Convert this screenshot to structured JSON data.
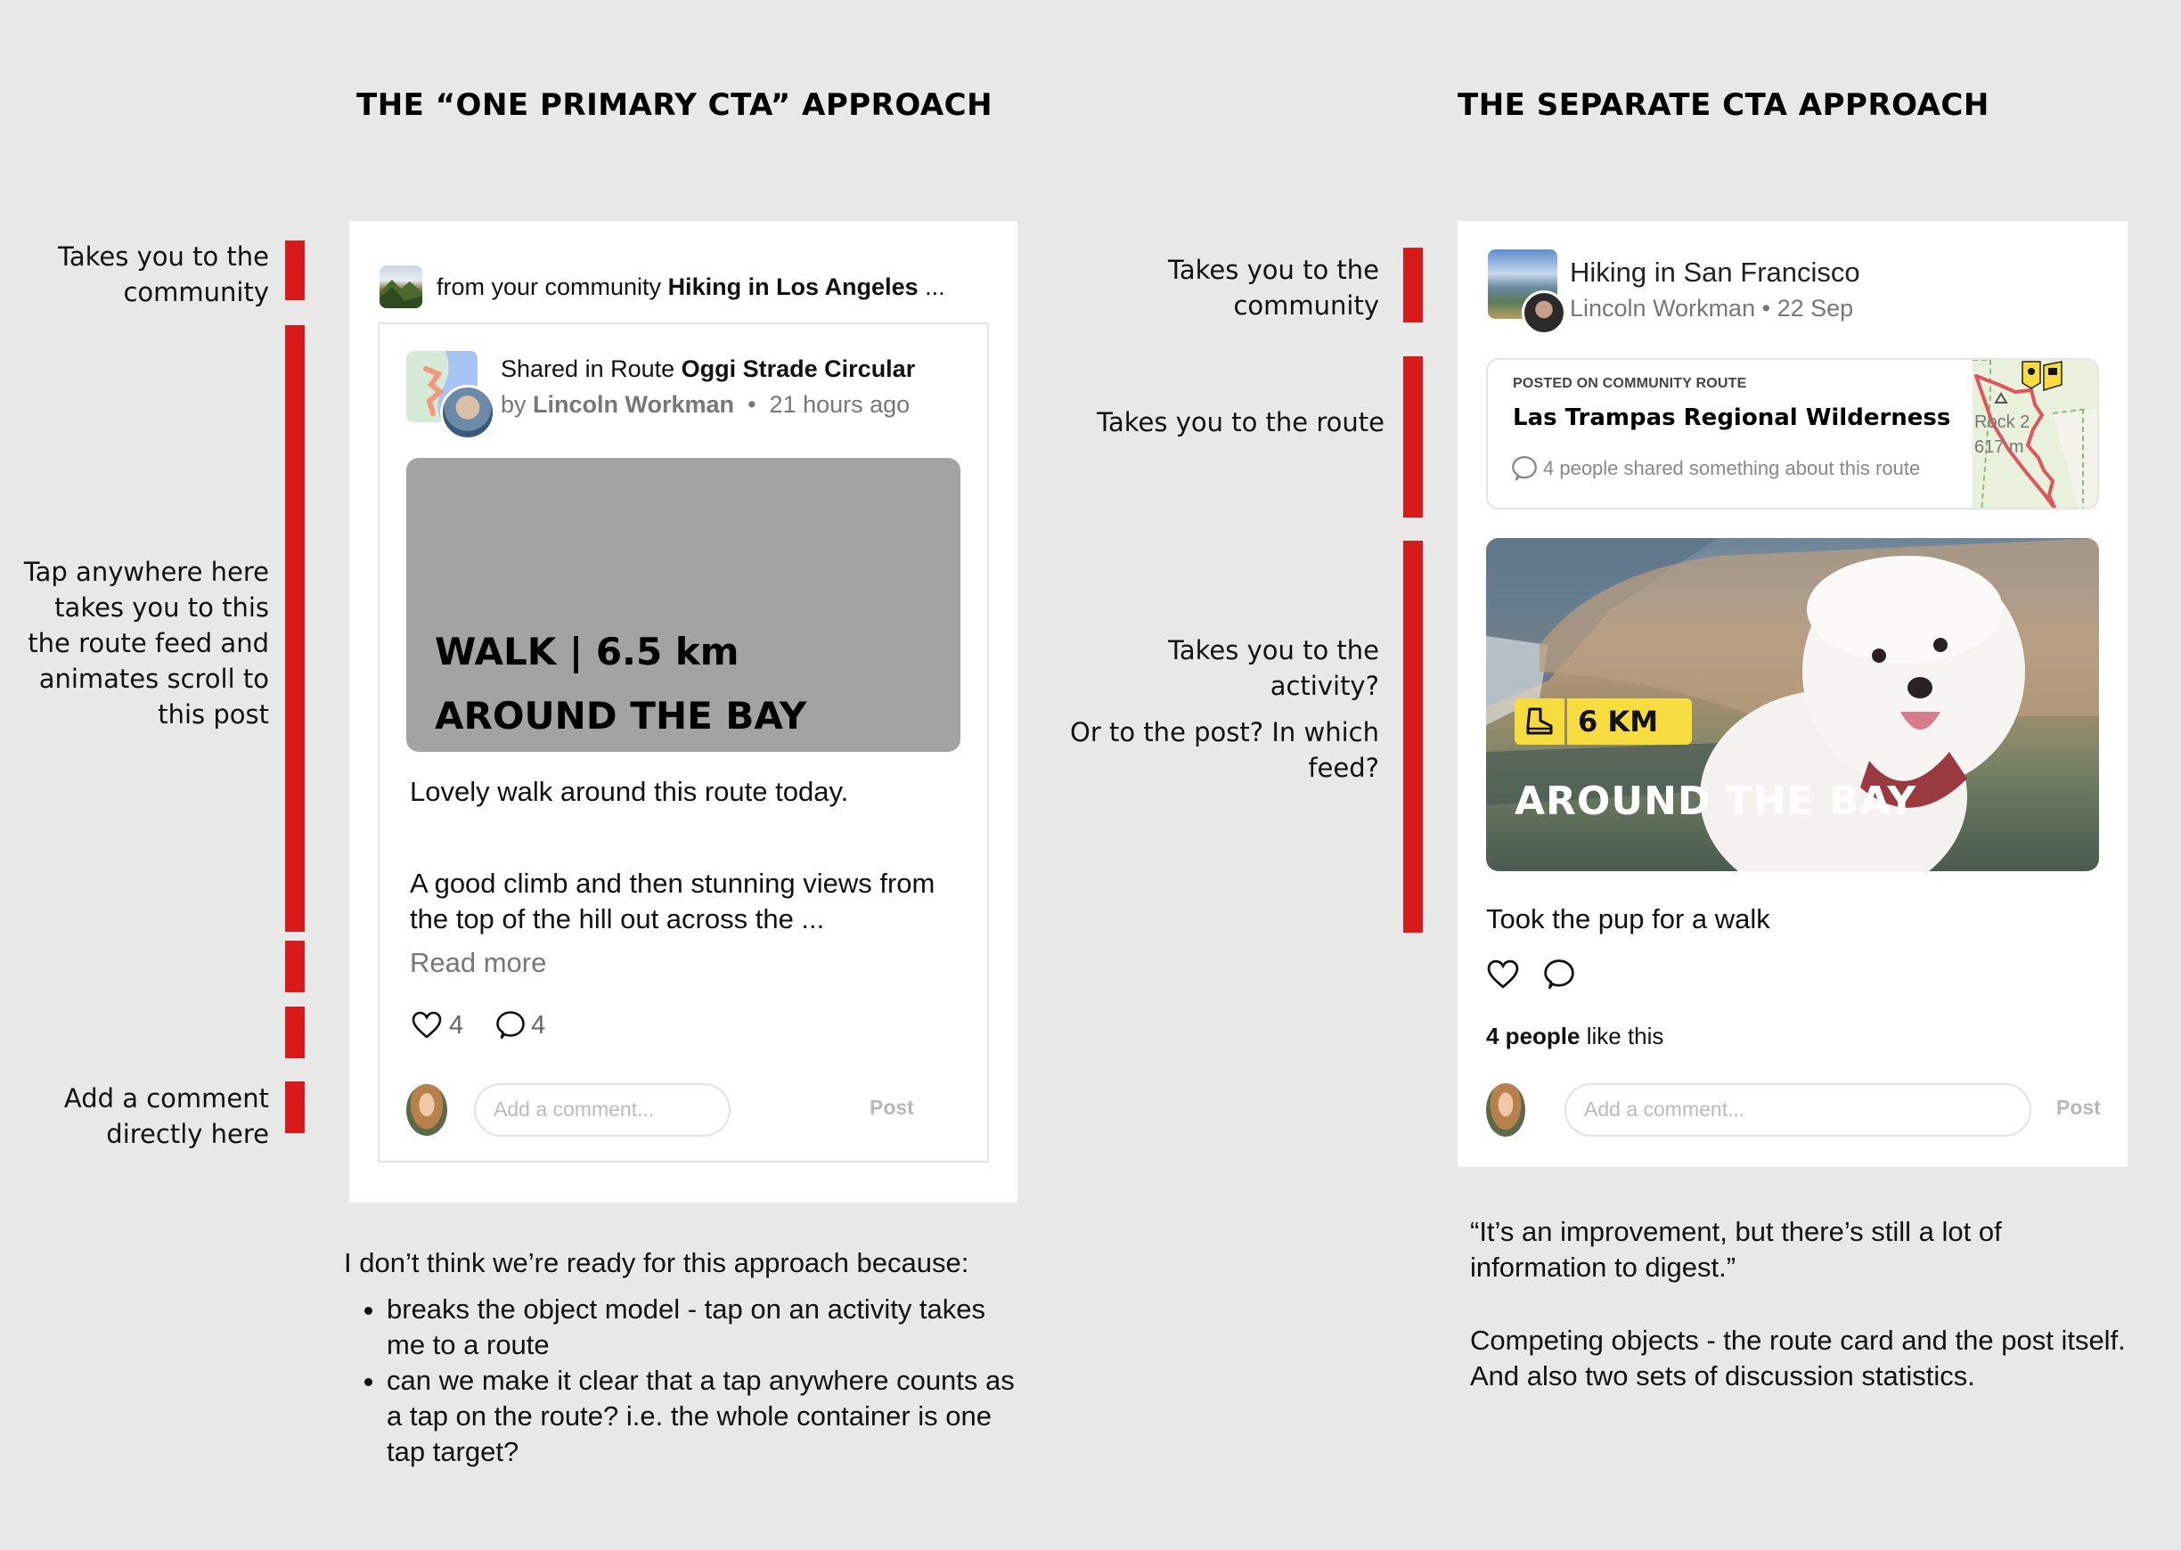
{
  "left": {
    "title": "THE “ONE PRIMARY CTA” APPROACH",
    "annotations": {
      "community": [
        "Takes you to the",
        "community"
      ],
      "tap_anywhere": [
        "Tap anywhere here",
        "takes you to this",
        "the route feed and",
        "animates scroll to",
        "this post"
      ],
      "comment": [
        "Add a comment",
        "directly here"
      ]
    },
    "card": {
      "community_prefix": "from your community ",
      "community_name": "Hiking in Los Angeles",
      "community_suffix": " ...",
      "shared_prefix": "Shared in Route ",
      "route_name": "Oggi Strade Circular",
      "by_prefix": "by ",
      "author": "Lincoln Workman",
      "separator": "•",
      "time": "21 hours ago",
      "banner_line1": "WALK | 6.5 km",
      "banner_line2": "AROUND THE BAY",
      "text1": "Lovely walk around this route today.",
      "text2_line1": "A good climb and then stunning views from",
      "text2_line2": "the top of the hill out across the ...",
      "read_more": "Read more",
      "likes": "4",
      "comments": "4",
      "comment_placeholder": "Add a comment...",
      "post_label": "Post"
    },
    "notes": {
      "intro": "I don’t think we’re ready for this approach because:",
      "bullets": [
        [
          "breaks the object model - tap on an activity takes",
          "me to a route"
        ],
        [
          "can we make it clear that a tap anywhere counts as",
          "a tap on the route? i.e. the whole container is one",
          "tap target?"
        ]
      ]
    }
  },
  "right": {
    "title": "THE SEPARATE CTA APPROACH",
    "annotations": {
      "community": [
        "Takes you to the",
        "community"
      ],
      "route": "Takes you to the route",
      "activity_q1": "Takes you to the activity?",
      "activity_q2": [
        "Or to the post? In which",
        "feed?"
      ]
    },
    "card": {
      "community_name": "Hiking in San Francisco",
      "author": "Lincoln Workman",
      "separator": "•",
      "date": "22 Sep",
      "route_label": "POSTED ON COMMUNITY ROUTE",
      "route_name": "Las Trampas Regional Wilderness",
      "route_stat": "4 people shared something about  this route",
      "map_peak_name": "Rock 2",
      "map_peak_elev": "617 m",
      "distance_badge": "6 KM",
      "banner_title": "AROUND THE BAY",
      "post_text": "Took the pup for a walk",
      "likes_bold": "4 people",
      "likes_rest": " like this",
      "comment_placeholder": "Add a comment...",
      "post_label": "Post"
    },
    "notes": {
      "quote": [
        "“It’s an improvement, but there’s still a lot of",
        "information to digest.”"
      ],
      "paragraph": [
        "Competing objects - the route card and the post itself.",
        "And also two sets of discussion statistics."
      ]
    }
  },
  "colors": {
    "background": "#e8e8e8",
    "annotation_bar": "#d91a1a",
    "badge_yellow": "#f7dc3f",
    "banner_grey": "#a3a3a3",
    "route_line": "#e0555c"
  }
}
